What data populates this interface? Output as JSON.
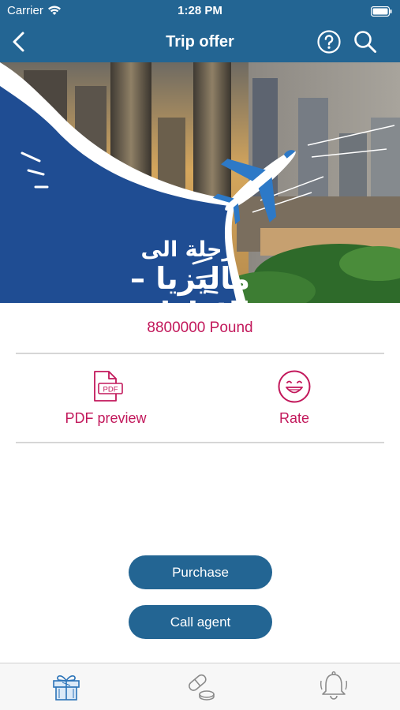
{
  "status_bar": {
    "carrier": "Carrier",
    "time": "1:28 PM"
  },
  "nav": {
    "title": "Trip offer"
  },
  "banner": {
    "line1": "رحلة الى",
    "line2": "ماليزيا – الامارات"
  },
  "offer": {
    "price": "8800000 Pound"
  },
  "actions": {
    "pdf_label": "PDF preview",
    "rate_label": "Rate"
  },
  "buttons": {
    "purchase": "Purchase",
    "call_agent": "Call agent"
  },
  "tabs": [
    {
      "icon": "gift-icon",
      "active": true
    },
    {
      "icon": "pills-icon",
      "active": false
    },
    {
      "icon": "bell-icon",
      "active": false
    }
  ],
  "colors": {
    "bar": "#236593",
    "accent": "#c2185b",
    "divider": "#d6d6d6"
  }
}
